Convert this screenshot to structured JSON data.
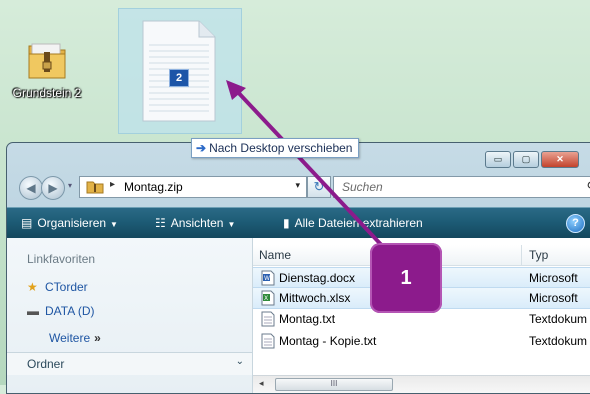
{
  "desktop": {
    "icon_label": "Grundstein 2",
    "drag_count": "2"
  },
  "tooltip": {
    "arrow": "➔",
    "text": "Nach Desktop verschieben"
  },
  "window": {
    "controls": {
      "minimize": "▭",
      "maximize": "▢",
      "close": "✕"
    },
    "address": {
      "separator": "▸",
      "crumb": "Montag.zip",
      "dropdown": "▾"
    },
    "search_placeholder": "Suchen",
    "toolbar": {
      "organize": "Organisieren",
      "views": "Ansichten",
      "extract": "Alle Dateien extrahieren",
      "help": "?"
    },
    "nav_pane": {
      "header": "Linkfavoriten",
      "items": [
        {
          "label": "CTorder",
          "icon": "star-icon"
        },
        {
          "label": "DATA (D)",
          "icon": "drive-icon"
        }
      ],
      "more": "Weitere",
      "more_glyph": "»",
      "footer": "Ordner",
      "footer_glyph": "⌄"
    },
    "columns": {
      "name": "Name",
      "type": "Typ"
    },
    "files": [
      {
        "name": "Dienstag.docx",
        "type": "Microsoft",
        "icon": "word-doc-icon",
        "selected": true
      },
      {
        "name": "Mittwoch.xlsx",
        "type": "Microsoft",
        "icon": "excel-doc-icon",
        "selected": true
      },
      {
        "name": "Montag.txt",
        "type": "Textdokum",
        "icon": "text-doc-icon",
        "selected": false
      },
      {
        "name": "Montag - Kopie.txt",
        "type": "Textdokum",
        "icon": "text-doc-icon",
        "selected": false
      }
    ],
    "scroll": {
      "left": "◂",
      "right": "▸",
      "thumb_grip": "III"
    }
  },
  "callout": {
    "number": "1"
  },
  "colors": {
    "annotation": "#8c1b8c",
    "toolbar": "#1c5a74",
    "desktop": "#c4e2cb"
  }
}
